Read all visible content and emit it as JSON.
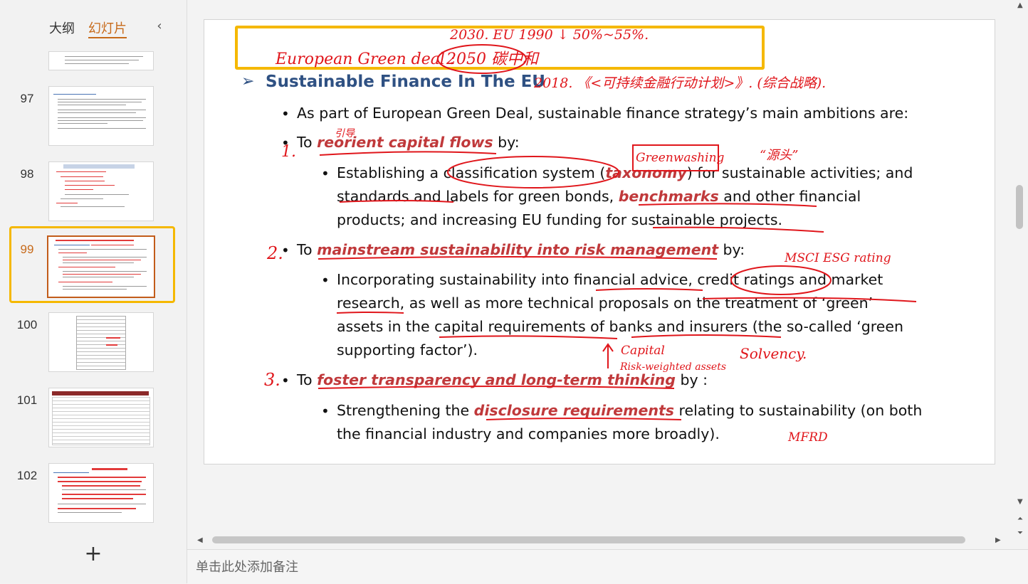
{
  "left_panel": {
    "tab_outline": "大纲",
    "tab_slides": "幻灯片",
    "collapse_icon": "‹",
    "add_icon": "+",
    "thumbnails": [
      {
        "num": "97"
      },
      {
        "num": "98"
      },
      {
        "num": "99",
        "active": true
      },
      {
        "num": "100"
      },
      {
        "num": "101"
      },
      {
        "num": "102"
      }
    ]
  },
  "slide": {
    "title": "Sustainable Finance In The EU",
    "intro": "As part of European Green Deal, sustainable finance strategy’s main ambitions are:",
    "p1_to": "To ",
    "p1_em": "reorient capital flows",
    "p1_by": " by:",
    "s1_a": "Establishing a classification system (",
    "s1_em1": "taxonomy",
    "s1_b": ") for sustainable activities; and",
    "s1_c": "standards and labels for green bonds, ",
    "s1_em2": "benchmarks",
    "s1_d": " and other financial",
    "s1_e": "products; and increasing EU funding for sustainable projects.",
    "p2_to": "To ",
    "p2_em": "mainstream sustainability into risk management",
    "p2_by": " by:",
    "s2_a": "Incorporating sustainability into financial advice, credit ratings and market",
    "s2_b": "research, as well as more technical proposals on the treatment of ‘green’",
    "s2_c": "assets in the capital requirements of banks and insurers (the so-called ‘green",
    "s2_d": "supporting factor’).",
    "p3_to": "To ",
    "p3_em": "foster transparency and long-term thinking",
    "p3_by": " by :",
    "s3_a": "Strengthening the ",
    "s3_em": "disclosure requirements",
    "s3_b": " relating to sustainability (on both",
    "s3_c": "the financial industry and companies more broadly)."
  },
  "annotations": {
    "top_line": "2030. EU 1990 ↓ 50%~55%.",
    "green_deal": "European Green deal :",
    "carbon": "2050 碳中和",
    "plan": "2018. 《<可持续金融行动计划>》. (综合战略).",
    "num1": "1.",
    "yinxiang": "引导",
    "greenwashing": "Greenwashing",
    "yuantou": "“源头”",
    "num2": "2.",
    "msci": "MSCI  ESG rating",
    "capital": "Capital",
    "rwa": "Risk-weighted assets",
    "solvency": "Solvency.",
    "num3": "3.",
    "mfrd": "MFRD"
  },
  "notes": {
    "placeholder": "单击此处添加备注"
  }
}
